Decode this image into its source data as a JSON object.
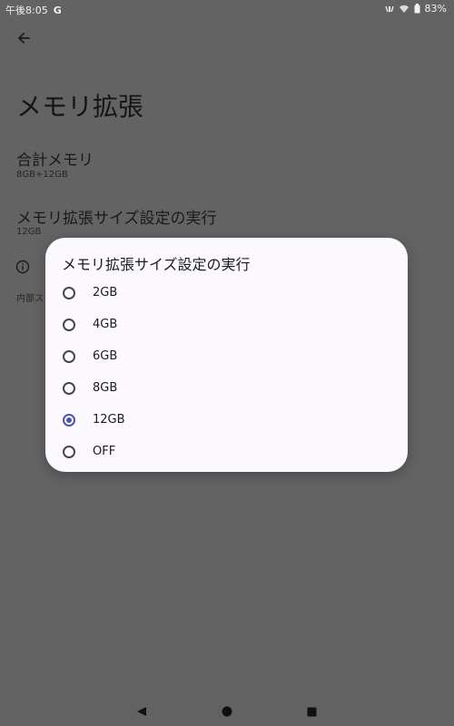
{
  "status_bar": {
    "time": "午後8:05",
    "g_label": "G",
    "battery": "83%"
  },
  "page": {
    "title": "メモリ拡張",
    "total_memory": {
      "title": "合計メモリ",
      "summary": "8GB+12GB"
    },
    "expansion_size": {
      "title": "メモリ拡張サイズ設定の実行",
      "summary": "12GB"
    },
    "footer_text": "内部ス"
  },
  "dialog": {
    "title": "メモリ拡張サイズ設定の実行",
    "selected": "12GB",
    "options": [
      {
        "label": "2GB",
        "checked": false
      },
      {
        "label": "4GB",
        "checked": false
      },
      {
        "label": "6GB",
        "checked": false
      },
      {
        "label": "8GB",
        "checked": false
      },
      {
        "label": "12GB",
        "checked": true
      },
      {
        "label": "OFF",
        "checked": false
      }
    ]
  },
  "icons": {
    "back": "arrow-left-icon",
    "info": "info-icon",
    "nav_back": "triangle-back-icon",
    "nav_home": "circle-home-icon",
    "nav_recents": "square-recents-icon"
  }
}
